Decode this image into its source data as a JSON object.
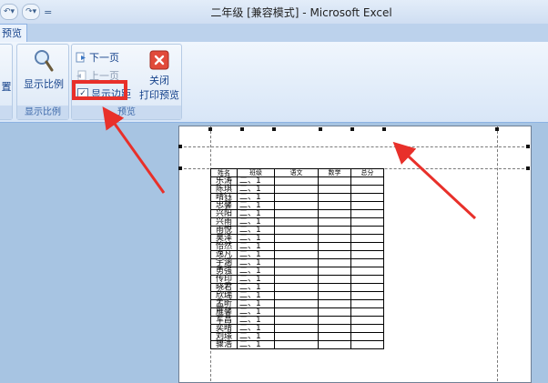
{
  "window": {
    "title": "二年级  [兼容模式] - Microsoft Excel"
  },
  "qat": {
    "items": [
      "↶",
      "↷",
      "="
    ]
  },
  "tabs": {
    "active": "预览"
  },
  "ribbon": {
    "partial_button": {
      "label": "置"
    },
    "zoom_group": {
      "zoom_button": "显示比例",
      "label": "显示比例"
    },
    "preview_group": {
      "next_page": "下一页",
      "prev_page": "上一页",
      "show_margins": "显示边距",
      "show_margins_checked": true,
      "close_preview_line1": "关闭",
      "close_preview_line2": "打印预览",
      "label": "预览"
    }
  },
  "sheet": {
    "headers": [
      "姓名",
      "班级",
      "语文",
      "数学",
      "总分"
    ],
    "rows": [
      [
        "乐涛",
        "二、1"
      ],
      [
        "陈琪",
        "二、1"
      ],
      [
        "晴钰",
        "二、1"
      ],
      [
        "忠馨",
        "二、1"
      ],
      [
        "兴阳",
        "二、1"
      ],
      [
        "兴雨",
        "二、1"
      ],
      [
        "雨悦",
        "二、1"
      ],
      [
        "昊泽",
        "二、1"
      ],
      [
        "怡然",
        "二、1"
      ],
      [
        "逸凡",
        "二、1"
      ],
      [
        "宇涵",
        "二、1"
      ],
      [
        "勇强",
        "二、1"
      ],
      [
        "传印",
        "二、1"
      ],
      [
        "晓君",
        "二、1"
      ],
      [
        "欣瑞",
        "二、1"
      ],
      [
        "孟昕",
        "二、1"
      ],
      [
        "雁馨",
        "二、1"
      ],
      [
        "军昌",
        "二、1"
      ],
      [
        "奕晴",
        "二、1"
      ],
      [
        "刘璟",
        "二、1"
      ],
      [
        "骤浩",
        "二、1"
      ]
    ]
  },
  "colors": {
    "annotation": "#e8302a",
    "workspace": "#a7c4e2"
  }
}
